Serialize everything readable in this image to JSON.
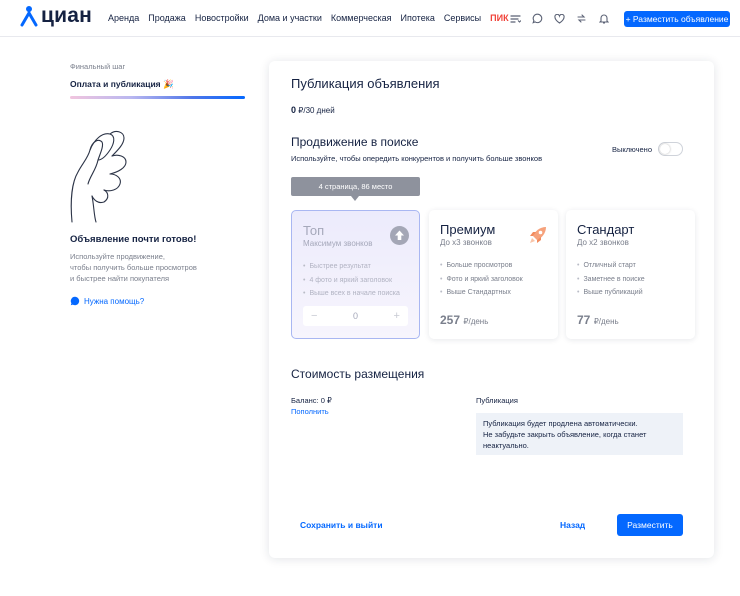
{
  "header": {
    "logo_text": "циан",
    "nav": [
      "Аренда",
      "Продажа",
      "Новостройки",
      "Дома и участки",
      "Коммерческая",
      "Ипотека",
      "Сервисы"
    ],
    "nav_pik": "ПИК",
    "icons": [
      "filter-list-icon",
      "chat-icon",
      "heart-icon",
      "compare-icon",
      "bell-icon"
    ],
    "post_button": "+ Разместить объявление",
    "accent": "#0468ff",
    "pik_color": "#f0433a"
  },
  "sidebar": {
    "step_label": "Финальный шаг",
    "step_title": "Оплата и публикация 🎉",
    "progress": 1.0,
    "ready_title": "Объявление почти готово!",
    "ready_lines": [
      "Используйте продвижение,",
      "чтобы получить больше просмотров",
      "и быстрее найти покупателя"
    ],
    "help_link": "Нужна помощь?"
  },
  "card": {
    "title": "Публикация объявления",
    "period_amount": "0",
    "period_rest": "₽/30 дней",
    "promo": {
      "title": "Продвижение в поиске",
      "subtitle": "Используйте, чтобы опередить конкурентов и получить больше звонков",
      "toggle_label": "Выключено",
      "toggle_on": false,
      "tooltip": "4 страница, 86 место"
    },
    "tariffs": [
      {
        "name": "Топ",
        "subtitle": "Максимум звонков",
        "features": [
          "Быстрее результат",
          "4 фото и яркий заголовок",
          "Выше всех в начале поиска"
        ],
        "stepper_value": "0",
        "icon": "arrow-up-circle-icon"
      },
      {
        "name": "Премиум",
        "subtitle": "До х3 звонков",
        "features": [
          "Больше просмотров",
          "Фото и яркий заголовок",
          "Выше Стандартных"
        ],
        "price": "257",
        "price_unit": "₽/день",
        "icon": "rocket-icon"
      },
      {
        "name": "Стандарт",
        "subtitle": "До х2 звонков",
        "features": [
          "Отличный старт",
          "Заметнее в поиске",
          "Выше публикаций"
        ],
        "price": "77",
        "price_unit": "₽/день"
      }
    ],
    "cost": {
      "title": "Стоимость размещения",
      "balance": "Баланс: 0 ₽",
      "topup": "Пополнить",
      "publication_label": "Публикация",
      "publication_lines": [
        "Публикация будет продлена автоматически.",
        "Не забудьте закрыть объявление, когда станет",
        "неактуально."
      ]
    },
    "actions": {
      "save_exit": "Сохранить и выйти",
      "back": "Назад",
      "publish": "Разместить"
    }
  }
}
